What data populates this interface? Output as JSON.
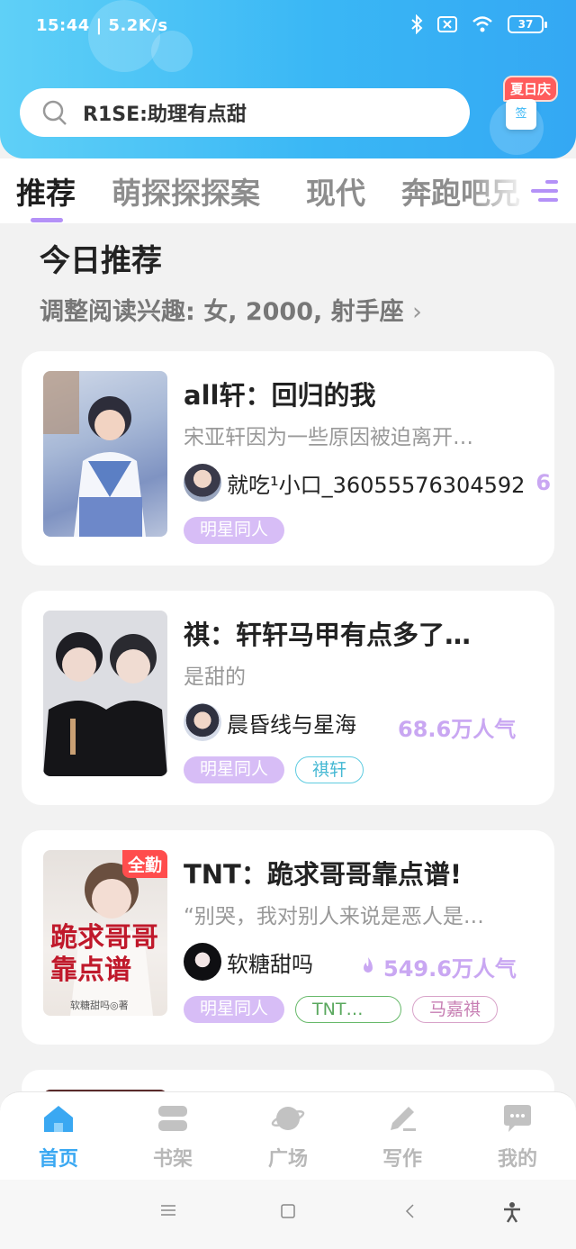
{
  "status_bar": {
    "time": "15:44",
    "net_speed": "5.2K/s",
    "battery": "37"
  },
  "search": {
    "text": "R1SE:助理有点甜"
  },
  "sign_in": {
    "badge": "夏日庆",
    "label": "签"
  },
  "tabs": [
    {
      "label": "推荐",
      "active": true
    },
    {
      "label": "萌探探探案"
    },
    {
      "label": "现代"
    },
    {
      "label": "奔跑吧兄"
    }
  ],
  "recommend": {
    "title": "今日推荐",
    "subtitle": "调整阅读兴趣: 女, 2000, 射手座"
  },
  "books": [
    {
      "title": "all轩：回归的我",
      "desc": "宋亚轩因为一些原因被迫离开…",
      "author": "就吃¹小口_36055576304592",
      "popularity": "6",
      "tags": [
        "明星同人"
      ]
    },
    {
      "title": "祺：轩轩马甲有点多了…",
      "desc": "是甜的",
      "author": "晨昏线与星海",
      "popularity": "68.6万人气",
      "tags": [
        "明星同人",
        "祺轩"
      ]
    },
    {
      "title": "TNT：跪求哥哥靠点谱!",
      "desc": "“别哭，我对别人来说是恶人是…",
      "author": "软糖甜吗",
      "popularity": "549.6万人气",
      "corner": "全勤",
      "cover_title": "跪求哥哥靠点谱",
      "cover_by": "软糖甜吗◎著",
      "tags": [
        "明星同人",
        "TNT…",
        "马嘉祺"
      ]
    }
  ],
  "bottom_nav": [
    {
      "label": "首页",
      "icon": "home-icon",
      "active": true
    },
    {
      "label": "书架",
      "icon": "bookshelf-icon"
    },
    {
      "label": "广场",
      "icon": "planet-icon"
    },
    {
      "label": "写作",
      "icon": "pen-icon"
    },
    {
      "label": "我的",
      "icon": "chat-bubble-icon"
    }
  ],
  "colors": {
    "accent": "#3aa8f2",
    "purple": "#b491f7",
    "header": "#3ab7f5"
  }
}
